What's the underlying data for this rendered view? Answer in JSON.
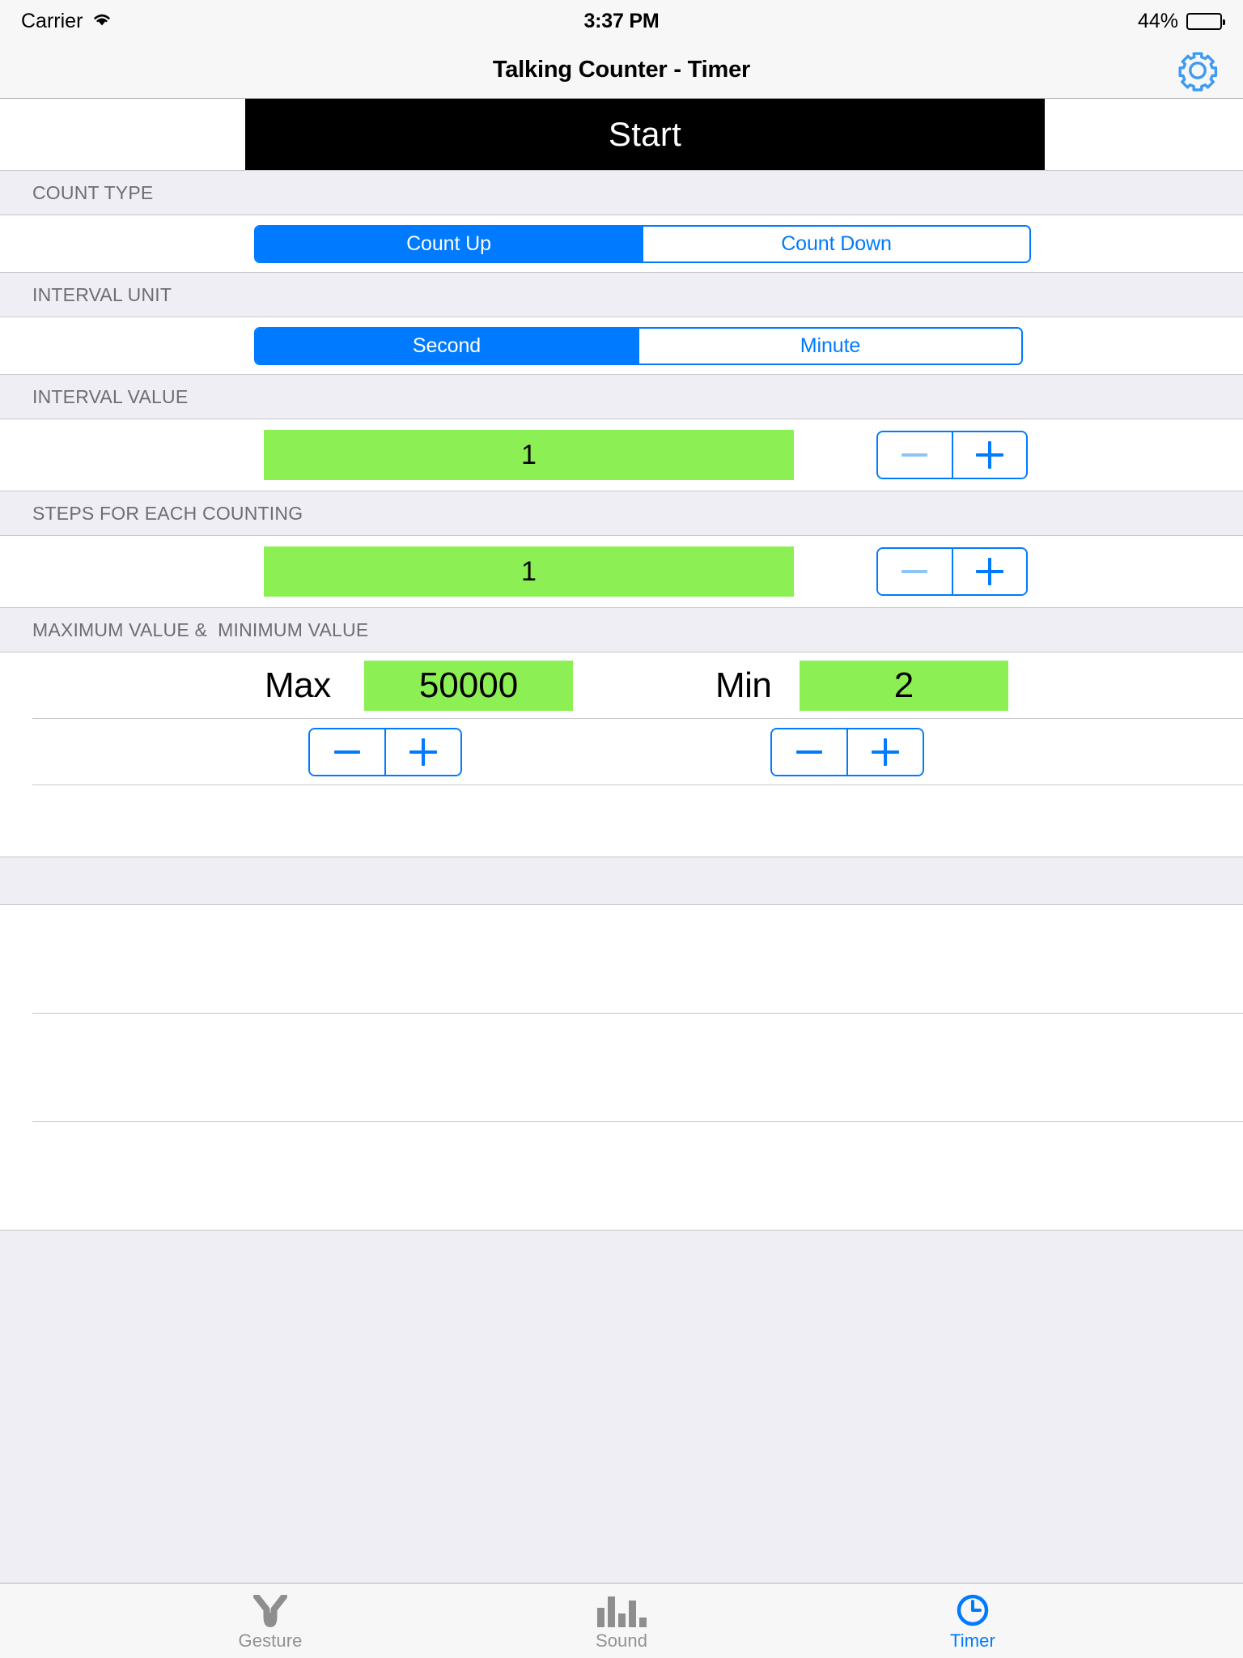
{
  "status_bar": {
    "carrier": "Carrier",
    "wifi_icon": "wifi-icon",
    "time": "3:37 PM",
    "battery_percent": "44%",
    "battery_level": 44,
    "battery_icon": "battery-icon"
  },
  "nav_bar": {
    "title": "Talking Counter - Timer",
    "settings_icon": "gear-icon"
  },
  "start": {
    "label": "Start"
  },
  "sections": {
    "count_type": {
      "header": "COUNT TYPE",
      "options": [
        "Count Up",
        "Count Down"
      ],
      "selected_index": 0
    },
    "interval_unit": {
      "header": "INTERVAL UNIT",
      "options": [
        "Second",
        "Minute"
      ],
      "selected_index": 0
    },
    "interval_value": {
      "header": "INTERVAL VALUE",
      "value": "1",
      "minus_label": "minus-icon",
      "plus_label": "plus-icon",
      "minus_disabled": true
    },
    "steps": {
      "header": "STEPS FOR EACH COUNTING",
      "value": "1",
      "minus_label": "minus-icon",
      "plus_label": "plus-icon",
      "minus_disabled": true
    },
    "min_max": {
      "header": "MAXIMUM VALUE &  MINIMUM VALUE",
      "max_label": "Max",
      "max_value": "50000",
      "min_label": "Min",
      "min_value": "2"
    },
    "empty_section": {
      "header": ""
    }
  },
  "tab_bar": {
    "tabs": [
      {
        "label": "Gesture",
        "icon": "gesture-hand-icon",
        "active": false
      },
      {
        "label": "Sound",
        "icon": "sound-bars-icon",
        "active": false
      },
      {
        "label": "Timer",
        "icon": "clock-icon",
        "active": true
      }
    ]
  },
  "colors": {
    "accent_blue": "#007AFF",
    "field_green": "#8CF055",
    "start_button_bg": "#000000",
    "table_bg": "#EFEEF4",
    "header_text": "#6D6D72"
  }
}
